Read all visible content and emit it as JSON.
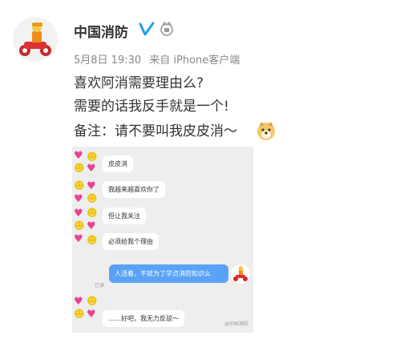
{
  "post": {
    "username": "中国消防",
    "date": "5月8日 19:30",
    "source": "来自 iPhone客户端",
    "lines": [
      "喜欢阿消需要理由么?",
      "需要的话我反手就是一个!",
      "备注：请不要叫我皮皮消～"
    ]
  },
  "chat": {
    "messages": [
      "皮皮消",
      "我越来越喜欢你了",
      "但让我关注",
      "必须给我个理由",
      "人活着，不就为了学点消防知识么",
      "……好吧，我无力反驳～"
    ],
    "read_label": "已读",
    "watermark": "@中国消防"
  },
  "colors": {
    "accent": "#5aa2f5",
    "verified": "#1f9ee8"
  },
  "icons": [
    "verified-icon",
    "rank-badge-icon",
    "doge-icon",
    "heart-icon",
    "smile-icon"
  ]
}
